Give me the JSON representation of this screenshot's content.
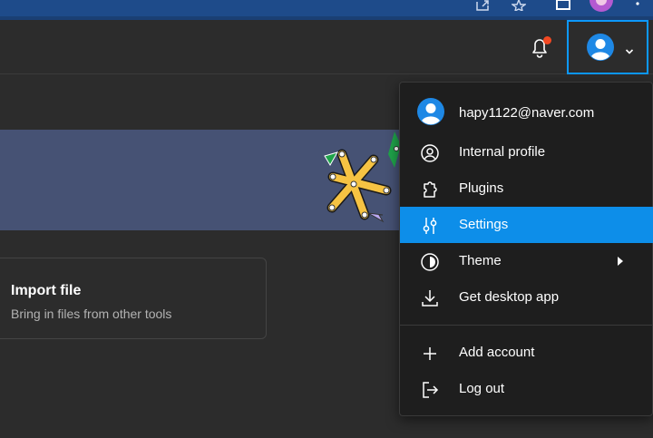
{
  "browser": {
    "icons": [
      "share-icon",
      "star-icon",
      "window-icon",
      "profile-icon",
      "more-icon"
    ]
  },
  "header": {
    "notification_icon": "bell-icon",
    "account_icon": "user-avatar-icon",
    "account_chevron": "chevron-down-icon"
  },
  "import_card": {
    "title": "Import file",
    "subtitle": "Bring in files from other tools"
  },
  "menu": {
    "email": "hapy1122@naver.com",
    "items": [
      {
        "label": "Internal profile",
        "icon": "user-circle-icon"
      },
      {
        "label": "Plugins",
        "icon": "puzzle-icon"
      },
      {
        "label": "Settings",
        "icon": "sliders-icon",
        "active": true
      },
      {
        "label": "Theme",
        "icon": "contrast-icon",
        "submenu": true
      },
      {
        "label": "Get desktop app",
        "icon": "download-icon"
      },
      {
        "label": "Add account",
        "icon": "plus-icon"
      },
      {
        "label": "Log out",
        "icon": "logout-icon"
      }
    ]
  },
  "colors": {
    "accent": "#0d8ee9",
    "focus_border": "#0d99ff",
    "notification_dot": "#f24822",
    "banner": "#465274",
    "menu_bg": "#1e1e1e",
    "page_bg": "#2c2c2c"
  }
}
